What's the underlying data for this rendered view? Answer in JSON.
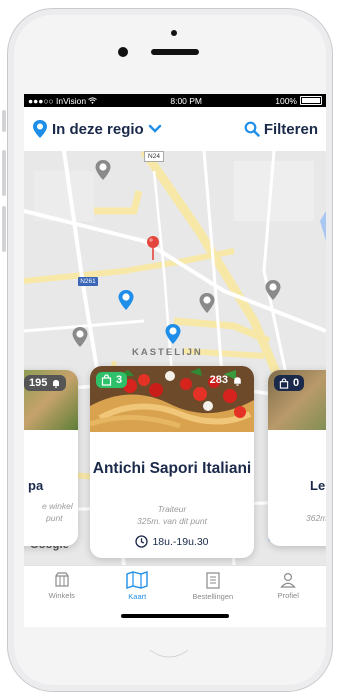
{
  "status": {
    "carrier": "●●●○○ InVision",
    "time": "8:00 PM",
    "battery": "100%"
  },
  "header": {
    "region_label": "In deze regio",
    "filter_label": "Filteren"
  },
  "map": {
    "road_labels": [
      "N24",
      "N261"
    ],
    "district_label": "KASTELIJN",
    "attribution": "Google"
  },
  "cards": [
    {
      "badge": "195",
      "name_part": "pa",
      "sub_part": "e winkel",
      "sub_part2": "punt"
    },
    {
      "badge_left": "3",
      "badge_right": "283",
      "name": "Antichi Sapori Italiani",
      "category": "Traiteur",
      "distance": "325m. van dit punt",
      "hours": "18u.-19u.30"
    },
    {
      "badge": "0",
      "name_part": "Le",
      "sub_part": "362m"
    }
  ],
  "tabs": [
    {
      "label": "Winkels",
      "icon": "shop-icon",
      "active": false
    },
    {
      "label": "Kaart",
      "icon": "map-icon",
      "active": true
    },
    {
      "label": "Bestellingen",
      "icon": "orders-icon",
      "active": false
    },
    {
      "label": "Profiel",
      "icon": "profile-icon",
      "active": false
    }
  ],
  "colors": {
    "accent": "#1e8ee8",
    "dark": "#1b2a4a",
    "badge_green": "#2fc16a"
  }
}
